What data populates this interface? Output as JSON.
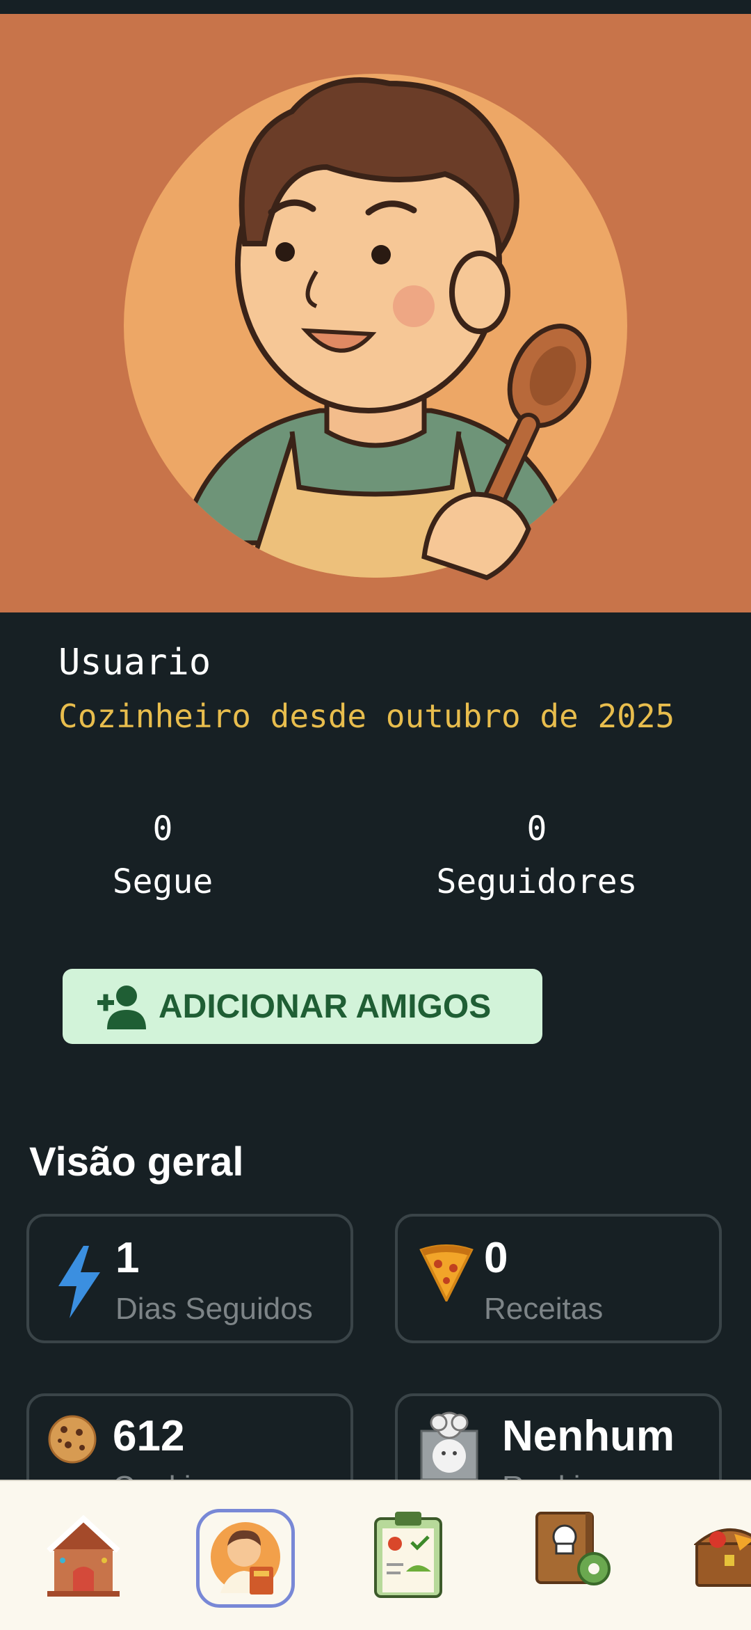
{
  "profile": {
    "name": "Usuario",
    "since": "Cozinheiro desde outubro de 2025"
  },
  "stats": {
    "following_count": "0",
    "following_label": "Segue",
    "followers_count": "0",
    "followers_label": "Seguidores"
  },
  "add_friends": {
    "label": "ADICIONAR AMIGOS",
    "icon": "person-add-icon"
  },
  "overview": {
    "title": "Visão geral",
    "cards": [
      {
        "icon": "lightning-icon",
        "value": "1",
        "label": "Dias Seguidos"
      },
      {
        "icon": "pizza-slice-icon",
        "value": "0",
        "label": "Receitas"
      },
      {
        "icon": "cookie-icon",
        "value": "612",
        "label": "Cookies"
      },
      {
        "icon": "no-rank-chef-badge-icon",
        "value": "Nenhum",
        "label": "Ranking"
      }
    ]
  },
  "nav": {
    "items": [
      {
        "icon": "gingerbread-house-icon",
        "selected": false
      },
      {
        "icon": "chef-avatar-book-icon",
        "selected": true
      },
      {
        "icon": "shopping-checklist-icon",
        "selected": false
      },
      {
        "icon": "recipe-book-settings-icon",
        "selected": false
      },
      {
        "icon": "treasure-chest-food-icon",
        "selected": false
      }
    ],
    "accent": "#7888d6"
  },
  "colors": {
    "hero_bg": "#c8744a",
    "accent_gold": "#e8bd4d",
    "button_bg": "#d2f3d9",
    "button_text": "#1f5e34"
  }
}
